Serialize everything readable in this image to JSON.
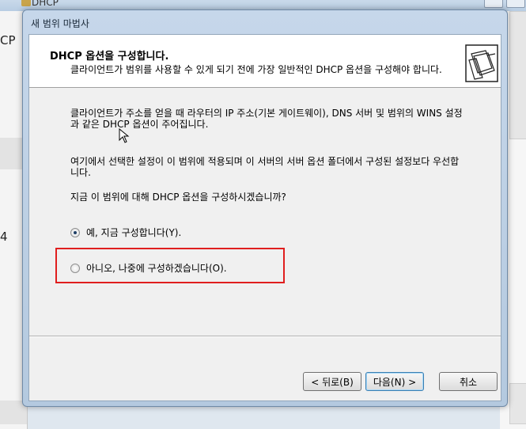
{
  "background": {
    "window_title": "DHCP",
    "left_text_1": "CP",
    "left_text_2": "4"
  },
  "dialog": {
    "title": "새 범위 마법사",
    "header_title": "DHCP 옵션을 구성합니다.",
    "header_subtitle": "클라이언트가 범위를 사용할 수 있게 되기 전에 가장 일반적인 DHCP 옵션을 구성해야 합니다.",
    "paragraph_1": "클라이언트가 주소를 얻을 때 라우터의 IP 주소(기본 게이트웨이), DNS 서버 및 범위의 WINS 설정과 같은 DHCP 옵션이 주어집니다.",
    "paragraph_2": "여기에서 선택한 설정이 이 범위에 적용되며 이 서버의 서버 옵션 폴더에서 구성된 설정보다 우선합니다.",
    "question": "지금 이 범위에 대해 DHCP 옵션을 구성하시겠습니까?",
    "options": [
      {
        "label": "예, 지금 구성합니다(Y).",
        "selected": true
      },
      {
        "label": "아니오, 나중에 구성하겠습니다(O).",
        "selected": false
      }
    ],
    "buttons": {
      "back": "< 뒤로(B)",
      "next": "다음(N) >",
      "cancel": "취소"
    }
  },
  "colors": {
    "highlight": "#e01e1e",
    "title_bar": "#c6d7ea"
  }
}
